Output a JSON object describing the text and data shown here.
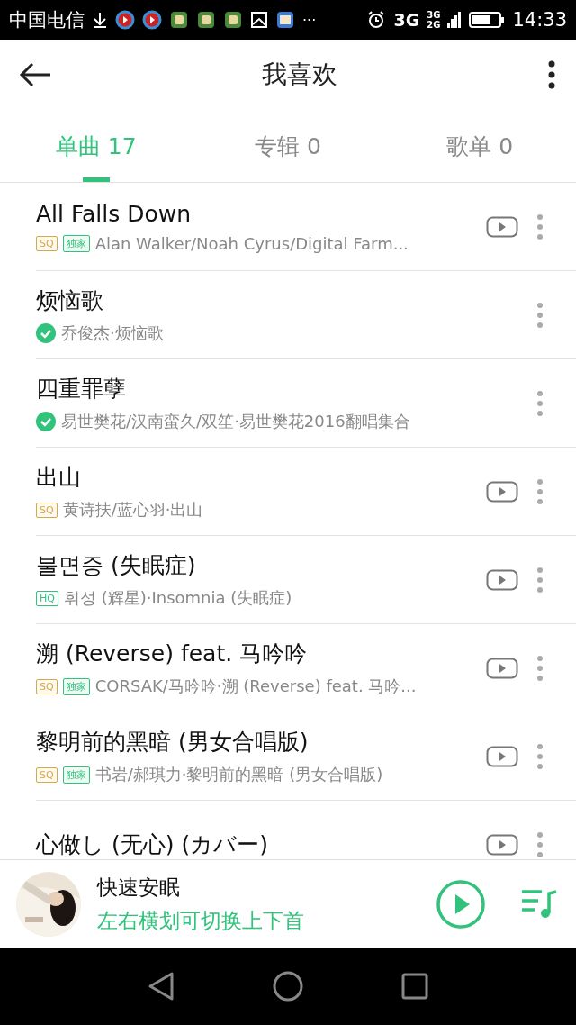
{
  "status_bar": {
    "carrier": "中国电信",
    "more": "···",
    "network": "3G",
    "network_small_top": "3G",
    "network_small_bottom": "2G",
    "time": "14:33"
  },
  "header": {
    "title": "我喜欢"
  },
  "tabs": [
    {
      "label": "单曲",
      "count": "17",
      "selected": true
    },
    {
      "label": "专辑",
      "count": "0",
      "selected": false
    },
    {
      "label": "歌单",
      "count": "0",
      "selected": false
    }
  ],
  "songs": [
    {
      "title": "All Falls Down",
      "badges": [
        {
          "kind": "sq",
          "label": "SQ"
        },
        {
          "kind": "exclusive",
          "label": "独家"
        }
      ],
      "downloaded": false,
      "subtitle": "Alan Walker/Noah Cyrus/Digital Farm...",
      "mv": true
    },
    {
      "title": "烦恼歌",
      "downloaded": true,
      "subtitle": "乔俊杰·烦恼歌",
      "mv": false
    },
    {
      "title": "四重罪孽",
      "downloaded": true,
      "subtitle": "易世樊花/汉南蛮久/双笙·易世樊花2016翻唱集合",
      "mv": false
    },
    {
      "title": "出山",
      "badges": [
        {
          "kind": "sq",
          "label": "SQ"
        }
      ],
      "downloaded": false,
      "subtitle": "黄诗扶/蓝心羽·出山",
      "mv": true
    },
    {
      "title": "불면증 (失眠症)",
      "badges": [
        {
          "kind": "hq",
          "label": "HQ"
        }
      ],
      "downloaded": false,
      "subtitle": "휘성 (辉星)·Insomnia (失眠症)",
      "mv": true
    },
    {
      "title": "溯 (Reverse) feat. 马吟吟",
      "badges": [
        {
          "kind": "sq",
          "label": "SQ"
        },
        {
          "kind": "exclusive",
          "label": "独家"
        }
      ],
      "downloaded": false,
      "subtitle": "CORSAK/马吟吟·溯 (Reverse) feat. 马吟...",
      "mv": true
    },
    {
      "title": "黎明前的黑暗 (男女合唱版)",
      "badges": [
        {
          "kind": "sq",
          "label": "SQ"
        },
        {
          "kind": "exclusive",
          "label": "独家"
        }
      ],
      "downloaded": false,
      "subtitle": "书岩/郝琪力·黎明前的黑暗 (男女合唱版)",
      "mv": true
    },
    {
      "title": "心做し (无心) (カバー)",
      "downloaded": false,
      "mv": true
    }
  ],
  "player": {
    "title": "快速安眠",
    "hint": "左右横划可切换上下首"
  }
}
